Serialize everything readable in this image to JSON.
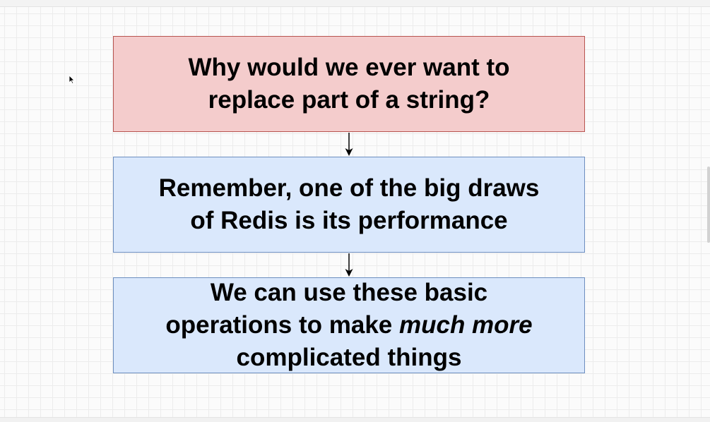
{
  "boxes": [
    {
      "id": "question",
      "line1": "Why would we ever want to",
      "line2": "replace part of a string?",
      "fill": "#f4cccc",
      "stroke": "#b85450"
    },
    {
      "id": "performance",
      "line1": "Remember, one of the big draws",
      "line2": "of Redis is its performance",
      "fill": "#dae8fc",
      "stroke": "#6c8ebf"
    },
    {
      "id": "basic-operations",
      "line1": "We can use these basic",
      "line2_before": "operations to make ",
      "line2_emphasis": "much more",
      "line3": "complicated things",
      "fill": "#dae8fc",
      "stroke": "#6c8ebf"
    }
  ],
  "connectors": [
    {
      "from": "question",
      "to": "performance"
    },
    {
      "from": "performance",
      "to": "basic-operations"
    }
  ]
}
